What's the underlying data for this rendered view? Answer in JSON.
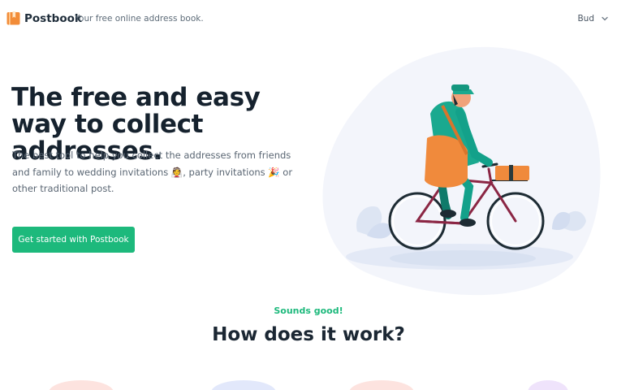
{
  "header": {
    "brand": "Postbook",
    "tagline": "Your free online address book.",
    "user_name": "Bud",
    "logo_icon": "book-icon",
    "menu_icon": "chevron-down-icon"
  },
  "hero": {
    "title": "The free and easy way to collect addresses.",
    "description_part1": "The best tool to help you collect the addresses from friends and family to wedding invitations",
    "emoji_wedding": "👰",
    "description_part2": ", party invitations",
    "emoji_party": "🎉",
    "description_part3": " or other traditional post.",
    "cta_label": "Get started with Postbook"
  },
  "section": {
    "eyebrow": "Sounds good!",
    "title": "How does it work?"
  },
  "colors": {
    "accent": "#1db97c",
    "text_dark": "#16222e",
    "logo": "#f08a3c"
  }
}
